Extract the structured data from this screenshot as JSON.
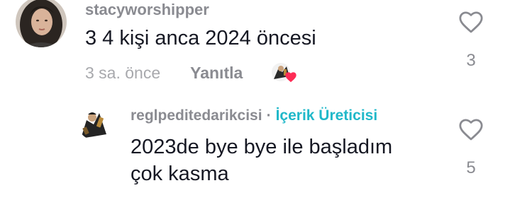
{
  "comments": [
    {
      "username": "stacyworshipper",
      "text": "3 4 kişi anca 2024 öncesi",
      "time": "3 sa. önce",
      "reply_label": "Yanıtla",
      "like_count": "3"
    },
    {
      "username": "reglpeditedarikcisi",
      "separator": "·",
      "creator_label": "İçerik Üreticisi",
      "text_lines": [
        "2023de bye bye ile başladım",
        "çok kasma"
      ],
      "like_count": "5"
    }
  ],
  "colors": {
    "username": "#8a8b91",
    "text": "#161823",
    "creator_accent": "#20b8c9",
    "heart_badge": "#fe2c55"
  },
  "icons": {
    "like": "heart-outline-icon",
    "creator_liked_badge": "heart-filled-icon"
  }
}
